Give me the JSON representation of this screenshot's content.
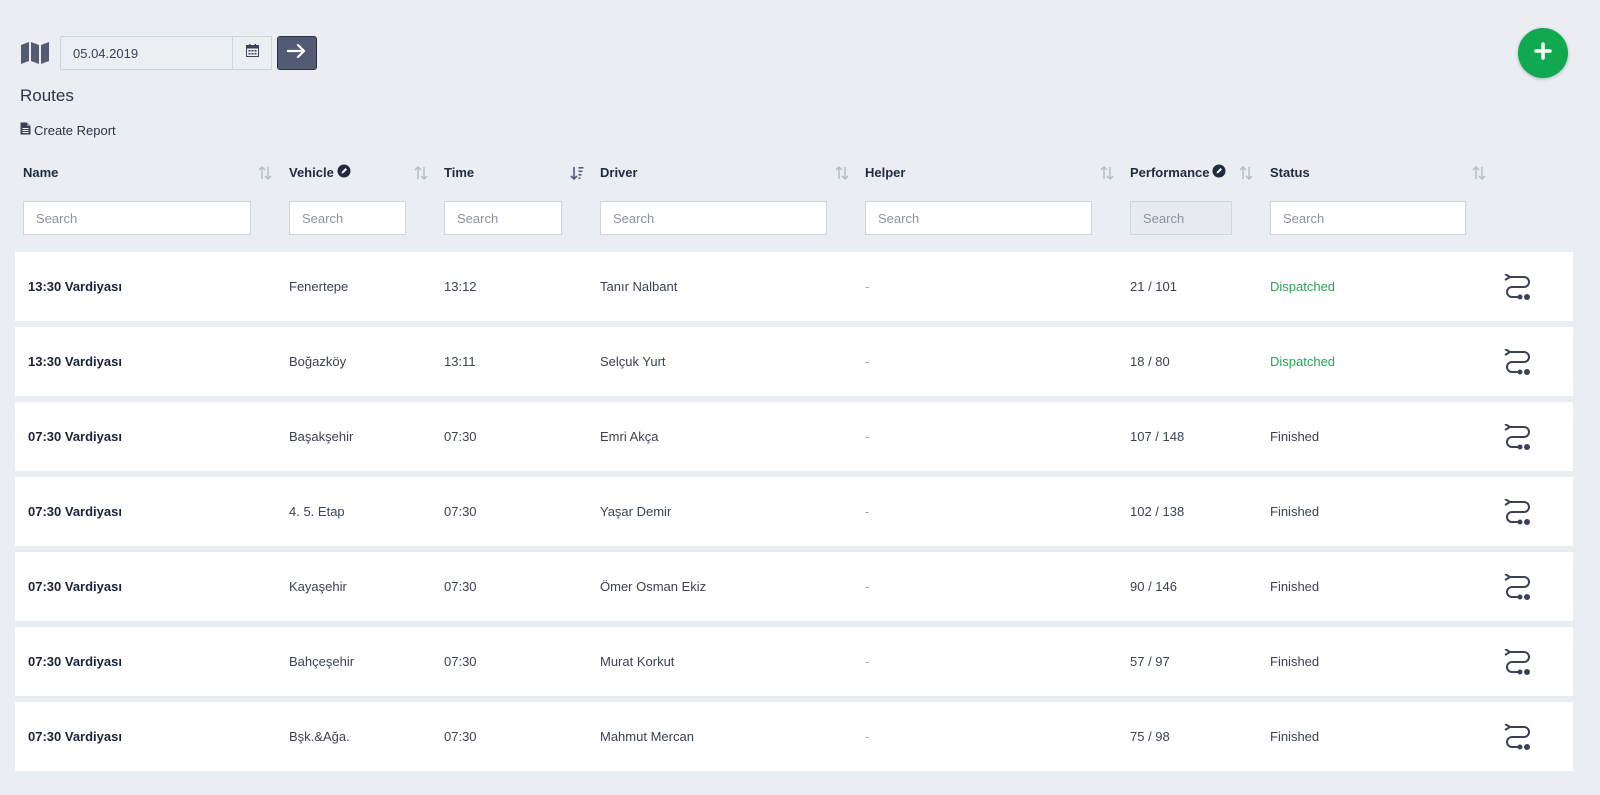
{
  "toolbar": {
    "date_value": "05.04.2019"
  },
  "page": {
    "title": "Routes",
    "create_report_label": "Create Report"
  },
  "columns": [
    {
      "key": "name",
      "label": "Name",
      "info": false,
      "search_placeholder": "Search"
    },
    {
      "key": "vehicle",
      "label": "Vehicle",
      "info": true,
      "search_placeholder": "Search"
    },
    {
      "key": "time",
      "label": "Time",
      "info": false,
      "search_placeholder": "Search"
    },
    {
      "key": "driver",
      "label": "Driver",
      "info": false,
      "search_placeholder": "Search"
    },
    {
      "key": "helper",
      "label": "Helper",
      "info": false,
      "search_placeholder": "Search"
    },
    {
      "key": "performance",
      "label": "Performance",
      "info": true,
      "search_placeholder": "Search"
    },
    {
      "key": "status",
      "label": "Status",
      "info": false,
      "search_placeholder": "Search"
    }
  ],
  "rows": [
    {
      "name": "13:30 Vardiyası",
      "vehicle": "Fenertepe",
      "time": "13:12",
      "driver": "Tanır Nalbant",
      "helper": "-",
      "performance": "21 / 101",
      "status": "Dispatched"
    },
    {
      "name": "13:30 Vardiyası",
      "vehicle": "Boğazköy",
      "time": "13:11",
      "driver": "Selçuk Yurt",
      "helper": "-",
      "performance": "18 / 80",
      "status": "Dispatched"
    },
    {
      "name": "07:30 Vardiyası",
      "vehicle": "Başakşehir",
      "time": "07:30",
      "driver": "Emri Akça",
      "helper": "-",
      "performance": "107 / 148",
      "status": "Finished"
    },
    {
      "name": "07:30 Vardiyası",
      "vehicle": "4. 5. Etap",
      "time": "07:30",
      "driver": "Yaşar Demir",
      "helper": "-",
      "performance": "102 / 138",
      "status": "Finished"
    },
    {
      "name": "07:30 Vardiyası",
      "vehicle": "Kayaşehir",
      "time": "07:30",
      "driver": "Ömer Osman Ekiz",
      "helper": "-",
      "performance": "90 / 146",
      "status": "Finished"
    },
    {
      "name": "07:30 Vardiyası",
      "vehicle": "Bahçeşehir",
      "time": "07:30",
      "driver": "Murat Korkut",
      "helper": "-",
      "performance": "57 / 97",
      "status": "Finished"
    },
    {
      "name": "07:30 Vardiyası",
      "vehicle": "Bşk.&Ağa.",
      "time": "07:30",
      "driver": "Mahmut Mercan",
      "helper": "-",
      "performance": "75 / 98",
      "status": "Finished"
    }
  ],
  "colors": {
    "accent_green": "#10a94f",
    "dispatched": "#27a65a",
    "dark_button": "#535a73"
  },
  "icons": [
    "map-icon",
    "calendar-icon",
    "arrow-right-icon",
    "plus-icon",
    "document-icon",
    "info-icon",
    "sort-icon",
    "route-icon"
  ]
}
